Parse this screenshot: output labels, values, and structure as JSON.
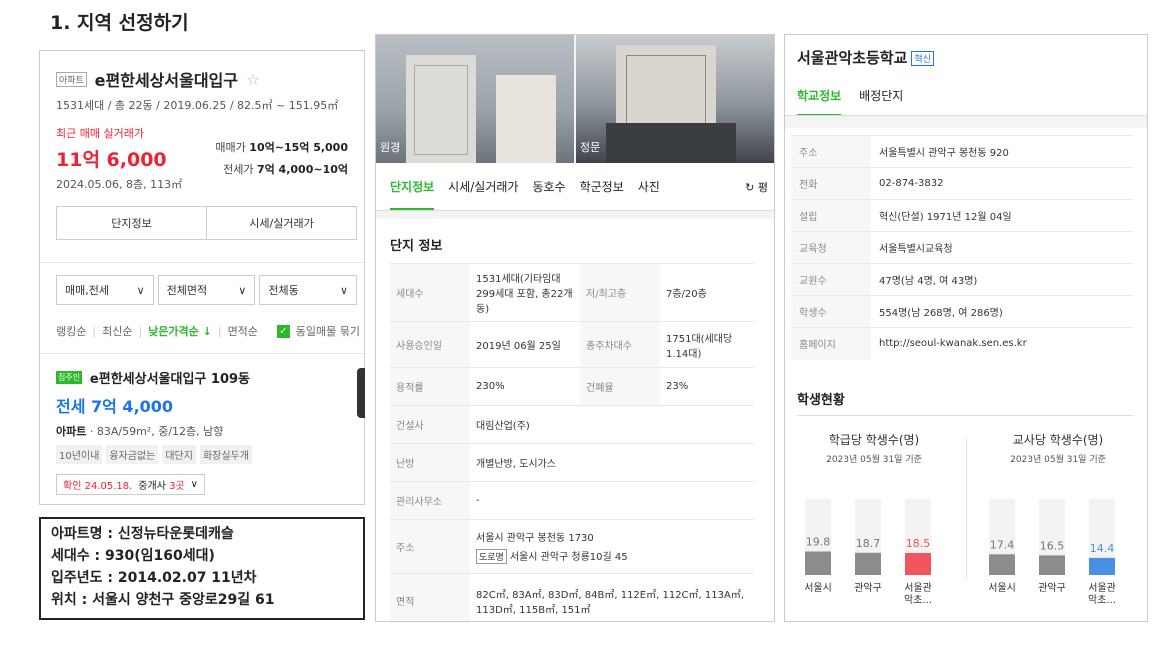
{
  "page_title": "1. 지역 선정하기",
  "panel1": {
    "tag": "아파트",
    "apt_name": "e편한세상서울대입구",
    "star": "☆",
    "meta": "1531세대 / 총 22동 / 2019.06.25 / 82.5㎡ ~ 151.95㎡",
    "recent_label": "최근 매매 실거래가",
    "recent_price": "11억 6,000",
    "recent_date": "2024.05.06, 8층, 113㎡",
    "sale_label": "매매가",
    "sale_range": "10억~15억 5,000",
    "lease_label": "전세가",
    "lease_range": "7억 4,000~10억",
    "btn_info": "단지정보",
    "btn_price": "시세/실거래가",
    "filters": [
      "매매,전세",
      "전체면적",
      "전체동"
    ],
    "sort_rank": "랭킹순",
    "sort_new": "최신순",
    "sort_low": "낮은가격순 ↓",
    "sort_area": "면적순",
    "check_icon": "✓",
    "group_same": "동일매물 묶기",
    "listing_tag": "집주인",
    "listing_name": "e편한세상서울대입구 109동",
    "listing_price": "전세 7억 4,000",
    "listing_type_bold": "아파트",
    "listing_type_rest": " · 83A/59m², 중/12층, 남향",
    "chips": [
      "10년이내",
      "융자금없는",
      "대단지",
      "화장실두개"
    ],
    "confirm_date": "확인 24.05.18.",
    "broker_prefix": "중개사 ",
    "broker_count": "3곳",
    "broker_chevron": "∨"
  },
  "infobox": {
    "line1": "아파트명 : 신정뉴타운롯데캐슬",
    "line2": "세대수 : 930(임160세대)",
    "line3": "입주년도 : 2014.02.07 11년차",
    "line4": "위치 : 서울시 양천구 중앙로29길 61"
  },
  "panel2": {
    "photo1_label": "원경",
    "photo2_label": "정문",
    "tabs": [
      "단지정보",
      "시세/실거래가",
      "동호수",
      "학군정보",
      "사진"
    ],
    "tab_last": "↻ 평",
    "section_title": "단지 정보",
    "rows": [
      {
        "k1": "세대수",
        "v1": "1531세대(기타임대 299세대 포함, 총22개동)",
        "k2": "저/최고층",
        "v2": "7층/20층"
      },
      {
        "k1": "사용승인일",
        "v1": "2019년 06월 25일",
        "k2": "총주차대수",
        "v2": "1751대(세대당 1.14대)"
      },
      {
        "k1": "용적률",
        "v1": "230%",
        "k2": "건폐율",
        "v2": "23%"
      },
      {
        "k1": "건설사",
        "v1": "대림산업(주)"
      },
      {
        "k1": "난방",
        "v1": "개별난방, 도시가스"
      },
      {
        "k1": "관리사무소",
        "v1": "-"
      },
      {
        "k1": "주소",
        "v1": "서울시 관악구 봉천동 1730",
        "badge": "도로명",
        "v1b": "서울시 관악구 청룡10길 45"
      },
      {
        "k1": "면적",
        "v1": "82C㎡, 83A㎡, 83D㎡, 84B㎡, 112E㎡, 112C㎡, 113A㎡, 113D㎡, 115B㎡, 151㎡"
      }
    ]
  },
  "panel3": {
    "school_name": "서울관악초등학교",
    "school_tag": "혁신",
    "tabs": [
      "학교정보",
      "배정단지"
    ],
    "rows": [
      {
        "k": "주소",
        "v": "서울특별시 관악구 봉천동 920"
      },
      {
        "k": "전화",
        "v": "02-874-3832"
      },
      {
        "k": "설립",
        "v": "혁신(단설) 1971년 12월 04일"
      },
      {
        "k": "교육청",
        "v": "서울특별시교육청"
      },
      {
        "k": "교원수",
        "v": "47명(남 4명, 여 43명)"
      },
      {
        "k": "학생수",
        "v": "554명(남 268명, 여 286명)"
      },
      {
        "k": "홈페이지",
        "v": "http://seoul-kwanak.sen.es.kr"
      }
    ],
    "status_title": "학생현황",
    "chart1": {
      "title": "학급당 학생수(명)",
      "sub": "2023년 05월 31일 기준"
    },
    "chart2": {
      "title": "교사당 학생수(명)",
      "sub": "2023년 05월 31일 기준"
    }
  },
  "chart_data": [
    {
      "type": "bar",
      "title": "학급당 학생수(명)",
      "categories": [
        "서울시",
        "관악구",
        "서울관악초..."
      ],
      "values": [
        19.8,
        18.7,
        18.5
      ],
      "colors": [
        "#8c8c8c",
        "#8c8c8c",
        "#f2555f"
      ],
      "ylim": [
        0,
        25
      ]
    },
    {
      "type": "bar",
      "title": "교사당 학생수(명)",
      "categories": [
        "서울시",
        "관악구",
        "서울관악초..."
      ],
      "values": [
        17.4,
        16.5,
        14.4
      ],
      "colors": [
        "#8c8c8c",
        "#8c8c8c",
        "#4a90e2"
      ],
      "ylim": [
        0,
        25
      ]
    }
  ]
}
